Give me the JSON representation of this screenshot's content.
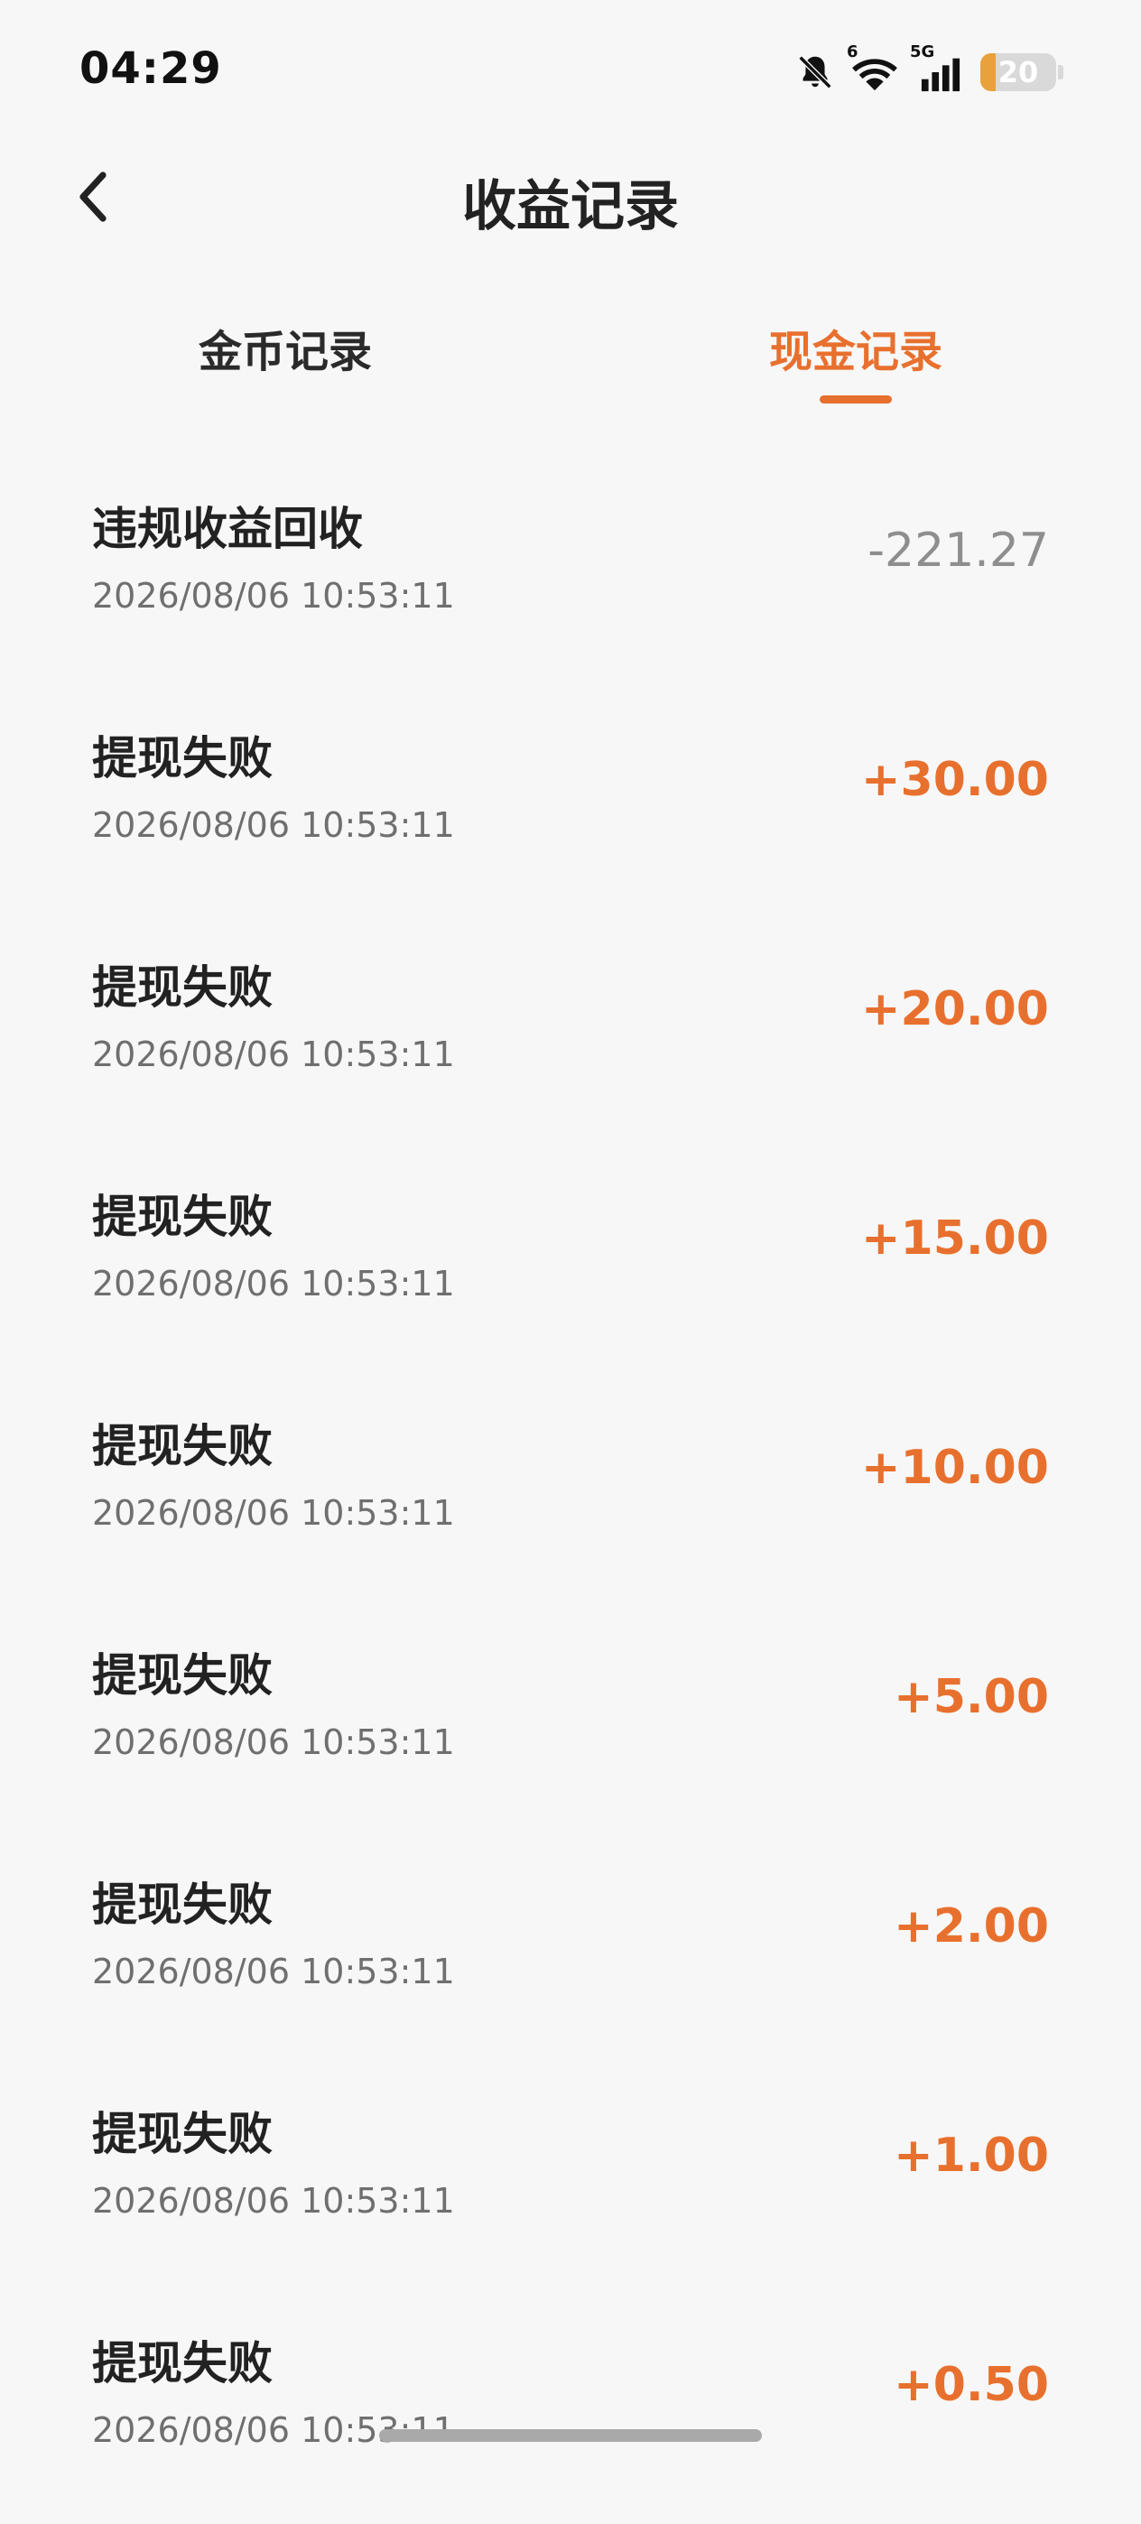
{
  "status_bar": {
    "time": "04:29",
    "battery": "20",
    "battery_level": 0.2,
    "wifi_badge": "6",
    "network_label": "5G",
    "icons": [
      "bell-muted-icon",
      "wifi-icon",
      "cell-signal-icon",
      "battery-icon"
    ]
  },
  "header": {
    "title": "收益记录",
    "back_icon": "chevron-left-icon"
  },
  "tabs": [
    {
      "label": "金币记录",
      "active": false
    },
    {
      "label": "现金记录",
      "active": true
    }
  ],
  "colors": {
    "accent": "#e8702e",
    "negative": "#8e8e8e",
    "background": "#f7f7f7"
  },
  "records": [
    {
      "title": "违规收益回收",
      "time": "2026/08/06 10:53:11",
      "amount": "-221.27"
    },
    {
      "title": "提现失败",
      "time": "2026/08/06 10:53:11",
      "amount": "+30.00"
    },
    {
      "title": "提现失败",
      "time": "2026/08/06 10:53:11",
      "amount": "+20.00"
    },
    {
      "title": "提现失败",
      "time": "2026/08/06 10:53:11",
      "amount": "+15.00"
    },
    {
      "title": "提现失败",
      "time": "2026/08/06 10:53:11",
      "amount": "+10.00"
    },
    {
      "title": "提现失败",
      "time": "2026/08/06 10:53:11",
      "amount": "+5.00"
    },
    {
      "title": "提现失败",
      "time": "2026/08/06 10:53:11",
      "amount": "+2.00"
    },
    {
      "title": "提现失败",
      "time": "2026/08/06 10:53:11",
      "amount": "+1.00"
    },
    {
      "title": "提现失败",
      "time": "2026/08/06 10:53:11",
      "amount": "+0.50"
    }
  ]
}
